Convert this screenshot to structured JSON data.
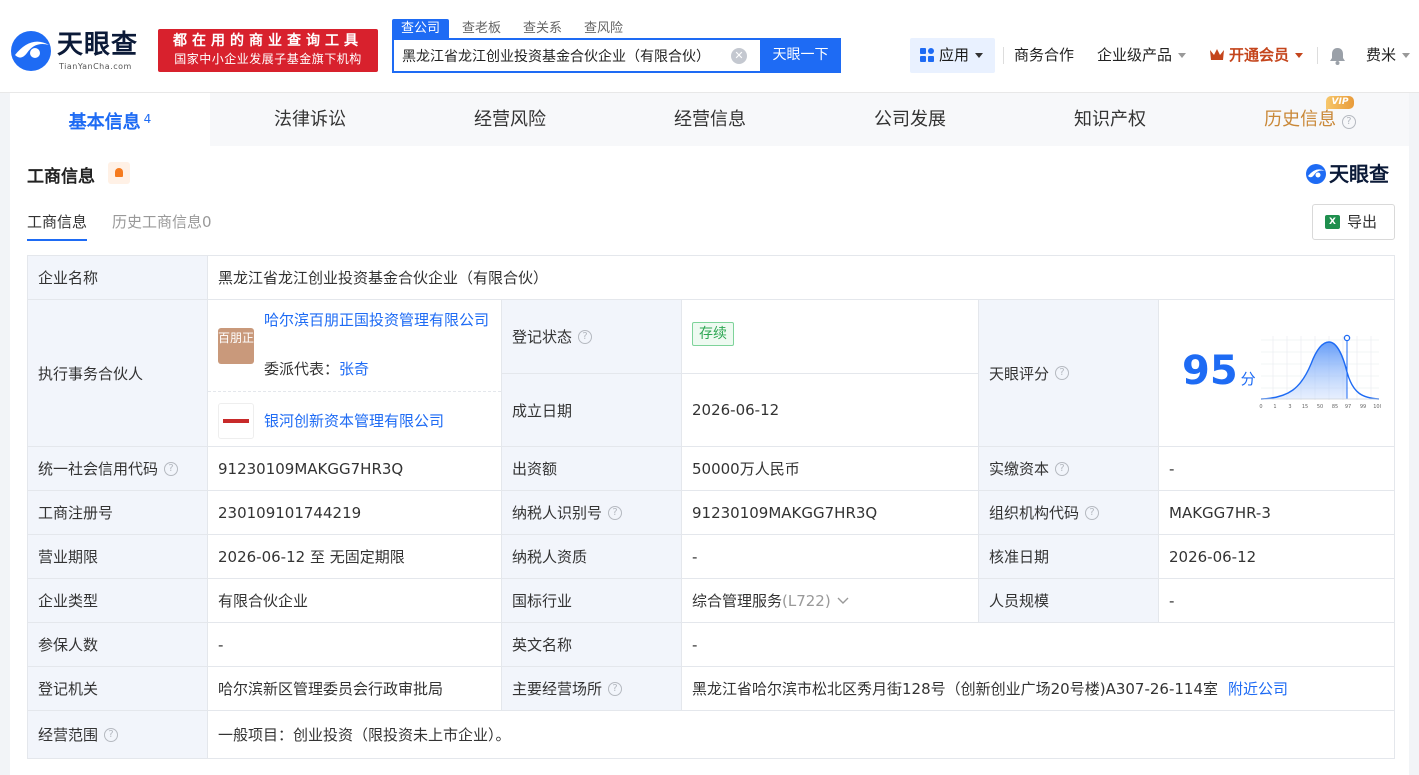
{
  "header": {
    "logo_text": "天眼查",
    "logo_sub": "TianYanCha.com",
    "slogan_line1": "都在用的商业查询工具",
    "slogan_line2": "国家中小企业发展子基金旗下机构",
    "search_tabs": [
      "查公司",
      "查老板",
      "查关系",
      "查风险"
    ],
    "search_value": "黑龙江省龙江创业投资基金合伙企业（有限合伙）",
    "search_button": "天眼一下",
    "clear_glyph": "✕",
    "nav": {
      "app": "应用",
      "business": "商务合作",
      "enterprise": "企业级产品",
      "vip": "开通会员",
      "user": "费米"
    }
  },
  "tabs": {
    "basic": "基本信息",
    "basic_count": "4",
    "legal": "法律诉讼",
    "risk": "经营风险",
    "operation": "经营信息",
    "development": "公司发展",
    "ip": "知识产权",
    "history": "历史信息",
    "vip_badge": "VIP"
  },
  "section": {
    "title": "工商信息",
    "brand": "天眼查",
    "subtab_current": "工商信息",
    "subtab_history": "历史工商信息0",
    "export": "导出",
    "xls_glyph": "X"
  },
  "info": {
    "company_name_label": "企业名称",
    "company_name": "黑龙江省龙江创业投资基金合伙企业（有限合伙）",
    "partner_label": "执行事务合伙人",
    "partner1_logo": "百朋正国",
    "partner1_name": "哈尔滨百朋正国投资管理有限公司",
    "delegate_label": "委派代表：",
    "delegate_name": "张奇",
    "partner2_name": "银河创新资本管理有限公司",
    "reg_status_label": "登记状态",
    "reg_status": "存续",
    "found_date_label": "成立日期",
    "found_date": "2026-06-12",
    "score_label": "天眼评分",
    "score": "95",
    "score_unit": "分",
    "score_axis": [
      "0",
      "1",
      "3",
      "15",
      "50",
      "85",
      "97",
      "99",
      "100"
    ],
    "credit_code_label": "统一社会信用代码",
    "credit_code": "91230109MAKGG7HR3Q",
    "contribution_label": "出资额",
    "contribution": "50000万人民币",
    "paid_capital_label": "实缴资本",
    "paid_capital": "-",
    "reg_no_label": "工商注册号",
    "reg_no": "230109101744219",
    "taxpayer_id_label": "纳税人识别号",
    "taxpayer_id": "91230109MAKGG7HR3Q",
    "org_code_label": "组织机构代码",
    "org_code": "MAKGG7HR-3",
    "term_label": "营业期限",
    "term": "2026-06-12 至 无固定期限",
    "taxpayer_qual_label": "纳税人资质",
    "taxpayer_qual": "-",
    "approve_date_label": "核准日期",
    "approve_date": "2026-06-12",
    "type_label": "企业类型",
    "type": "有限合伙企业",
    "industry_label": "国标行业",
    "industry": "综合管理服务",
    "industry_code": "(L722)",
    "staff_size_label": "人员规模",
    "staff_size": "-",
    "insured_label": "参保人数",
    "insured": "-",
    "english_name_label": "英文名称",
    "english_name": "-",
    "authority_label": "登记机关",
    "authority": "哈尔滨新区管理委员会行政审批局",
    "address_label": "主要经营场所",
    "address": "黑龙江省哈尔滨市松北区秀月街128号（创新创业广场20号楼)A307-26-114室",
    "nearby": "附近公司",
    "scope_label": "经营范围",
    "scope": "一般项目：创业投资（限投资未上市企业）。"
  },
  "colors": {
    "brand_blue": "#1e6bf4",
    "slogan_red": "#d8212d",
    "status_green": "#2fa754"
  }
}
